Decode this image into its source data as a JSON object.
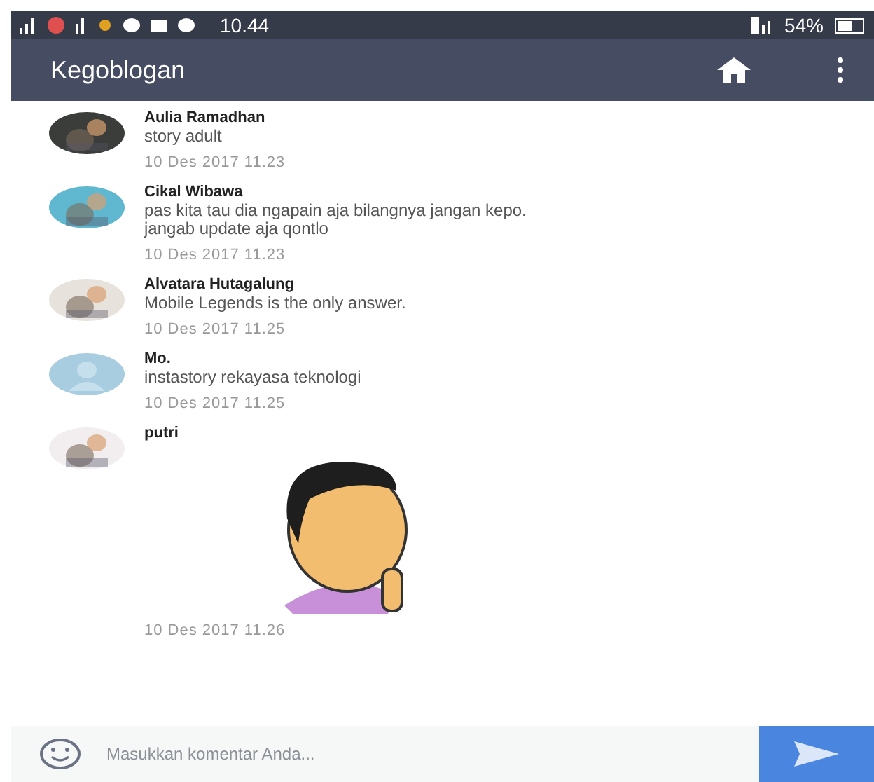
{
  "status_bar": {
    "time": "10.44",
    "battery": "54%"
  },
  "app_bar": {
    "title": "Kegoblogan"
  },
  "comments": [
    {
      "author": "Aulia Ramadhan",
      "text": "story adult",
      "date": "10 Des 2017 11.23"
    },
    {
      "author": "Cikal Wibawa",
      "text": "pas kita tau dia ngapain aja bilangnya jangan kepo. jangab update aja qontlo",
      "date": "10 Des 2017 11.23"
    },
    {
      "author": "Alvatara Hutagalung",
      "text": "Mobile Legends is the only answer.",
      "date": "10 Des 2017 11.25"
    },
    {
      "author": "Mo.",
      "avatar": {
        "kind": "default",
        "color": "#a9cde0"
      },
      "text": "instastory rekayasa teknologi",
      "date": "10 Des 2017 11.25"
    },
    {
      "author": "putri",
      "date": "10 Des 2017 11.26"
    }
  ],
  "composer": {
    "placeholder": "Masukkan komentar Anda..."
  }
}
